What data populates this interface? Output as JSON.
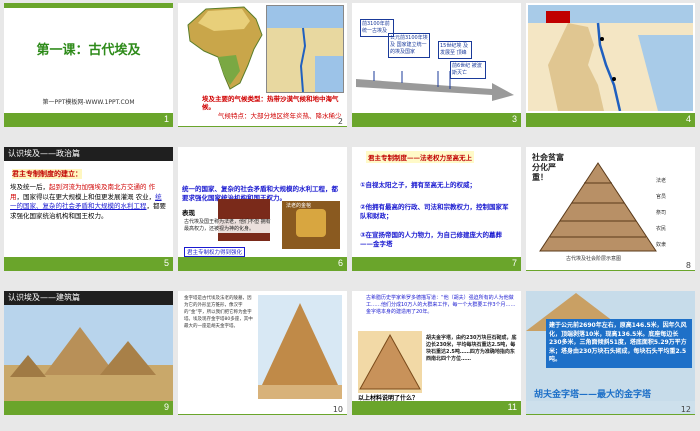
{
  "slides": [
    {
      "num": "1",
      "title": "第一课：古代埃及",
      "footer": "第一PPT模板网-WWW.1PPT.COM"
    },
    {
      "num": "2",
      "climate": "埃及主要的气候类型：热带沙漠气候和地中海气候。",
      "climate_feature": "气候特点：大部分地区终年炎热、降水稀少"
    },
    {
      "num": "3",
      "timeline": [
        "前3100年前 统一古埃及",
        "公元前3100年埃及 国家建立统一的埃及国家",
        "15世纪埃 及发展至 顶峰",
        "前6世纪 被波斯灭亡"
      ]
    },
    {
      "num": "4"
    },
    {
      "num": "5",
      "header": "认识埃及——政治篇",
      "subtitle": "君主专制制度的建立：",
      "body_1": "埃及统一后，",
      "body_red": "起到河流为加强埃及南北方交通的 作用",
      "body_2": "，国家得以在更大规模上和但更发展灌溉 农业，",
      "body_blue": "统一的国家、复杂的社会矛盾和大规模的水利工程",
      "body_3": "，都要求强化国家统治机构和国王权力。"
    },
    {
      "num": "6",
      "text": "统一的国家、复杂的社会矛盾和大规模的水利工程，都要求强化国家统治机构和国王权力。",
      "label": "表现",
      "caption": "法老的金棺",
      "note": "古代埃及国王称为法老，他们不但 拥有最高权力，还被视为神的化身。",
      "sub": "君主专制权力得到强化"
    },
    {
      "num": "7",
      "title": "君主专制制度——法老权力至高无上",
      "points": [
        "①自视太阳之子，拥有至高无上的权威；",
        "②他拥有最高的行政、司法和宗教权力，控制国家军队和财政；",
        "③在宣扬帝国的人力物力，为自己修建庞大的墓葬——金字塔"
      ]
    },
    {
      "num": "8",
      "title": "社会贫富 分化严重！",
      "caption": "古代埃及社会阶层示意图",
      "labels": [
        "法老",
        "官员",
        "祭司",
        "农民",
        "奴隶"
      ]
    },
    {
      "num": "9",
      "header": "认识埃及——建筑篇"
    },
    {
      "num": "10",
      "text": "金字塔是古代埃及法老的陵墓，因为它的外形呈方锥形，像汉字的“金”字，所以我们把它称为金字塔。埃及现存金字塔80多座，其中最大的一座是胡夫金字塔。"
    },
    {
      "num": "11",
      "text_1": "古希腊历史学家希罗多德描写道：“他（胡夫）强迫所有的人为他做工……他们分成10万人的大群来工作，每一个大群要工作3个月……金字塔本身的建造用了20年。",
      "text_2": "胡夫金字塔，由约230万块巨石砌成，底边长230米，平均每块石重达2.5吨，每块石重达2.5吨……四方为准确地指向东西南北四个方位……",
      "question": "以上材料说明了什么？"
    },
    {
      "num": "12",
      "text": "建于公元前2690年左右，原高146.5米，因年久风化，顶端剥落10米，现高136.5米。底座每边长230多米，三角面倾斜51度，塔底面积5.29万平方米；塔身由230万块石头砌成，每块石头平均重2.5吨。",
      "caption": "胡夫金字塔——最大的金字塔"
    }
  ]
}
